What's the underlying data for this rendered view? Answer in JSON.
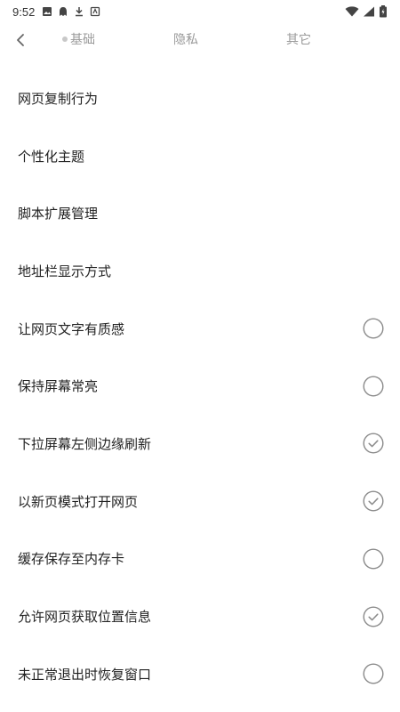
{
  "status_bar": {
    "time": "9:52",
    "left_icons": [
      "image-icon",
      "ghost-icon",
      "download-icon",
      "app-icon"
    ],
    "right_icons": [
      "wifi-icon",
      "signal-icon",
      "battery-icon"
    ]
  },
  "tabs": [
    {
      "label": "基础",
      "active": true
    },
    {
      "label": "隐私",
      "active": false
    },
    {
      "label": "其它",
      "active": false
    }
  ],
  "settings": [
    {
      "label": "网页复制行为",
      "has_toggle": false
    },
    {
      "label": "个性化主题",
      "has_toggle": false
    },
    {
      "label": "脚本扩展管理",
      "has_toggle": false
    },
    {
      "label": "地址栏显示方式",
      "has_toggle": false
    },
    {
      "label": "让网页文字有质感",
      "has_toggle": true,
      "checked": false
    },
    {
      "label": "保持屏幕常亮",
      "has_toggle": true,
      "checked": false
    },
    {
      "label": "下拉屏幕左侧边缘刷新",
      "has_toggle": true,
      "checked": true
    },
    {
      "label": "以新页模式打开网页",
      "has_toggle": true,
      "checked": true
    },
    {
      "label": "缓存保存至内存卡",
      "has_toggle": true,
      "checked": false
    },
    {
      "label": "允许网页获取位置信息",
      "has_toggle": true,
      "checked": true
    },
    {
      "label": "未正常退出时恢复窗口",
      "has_toggle": true,
      "checked": false
    }
  ],
  "colors": {
    "toggle_stroke": "#8a8a8a",
    "tab_text": "#9a9a9a",
    "label_text": "#222222"
  }
}
